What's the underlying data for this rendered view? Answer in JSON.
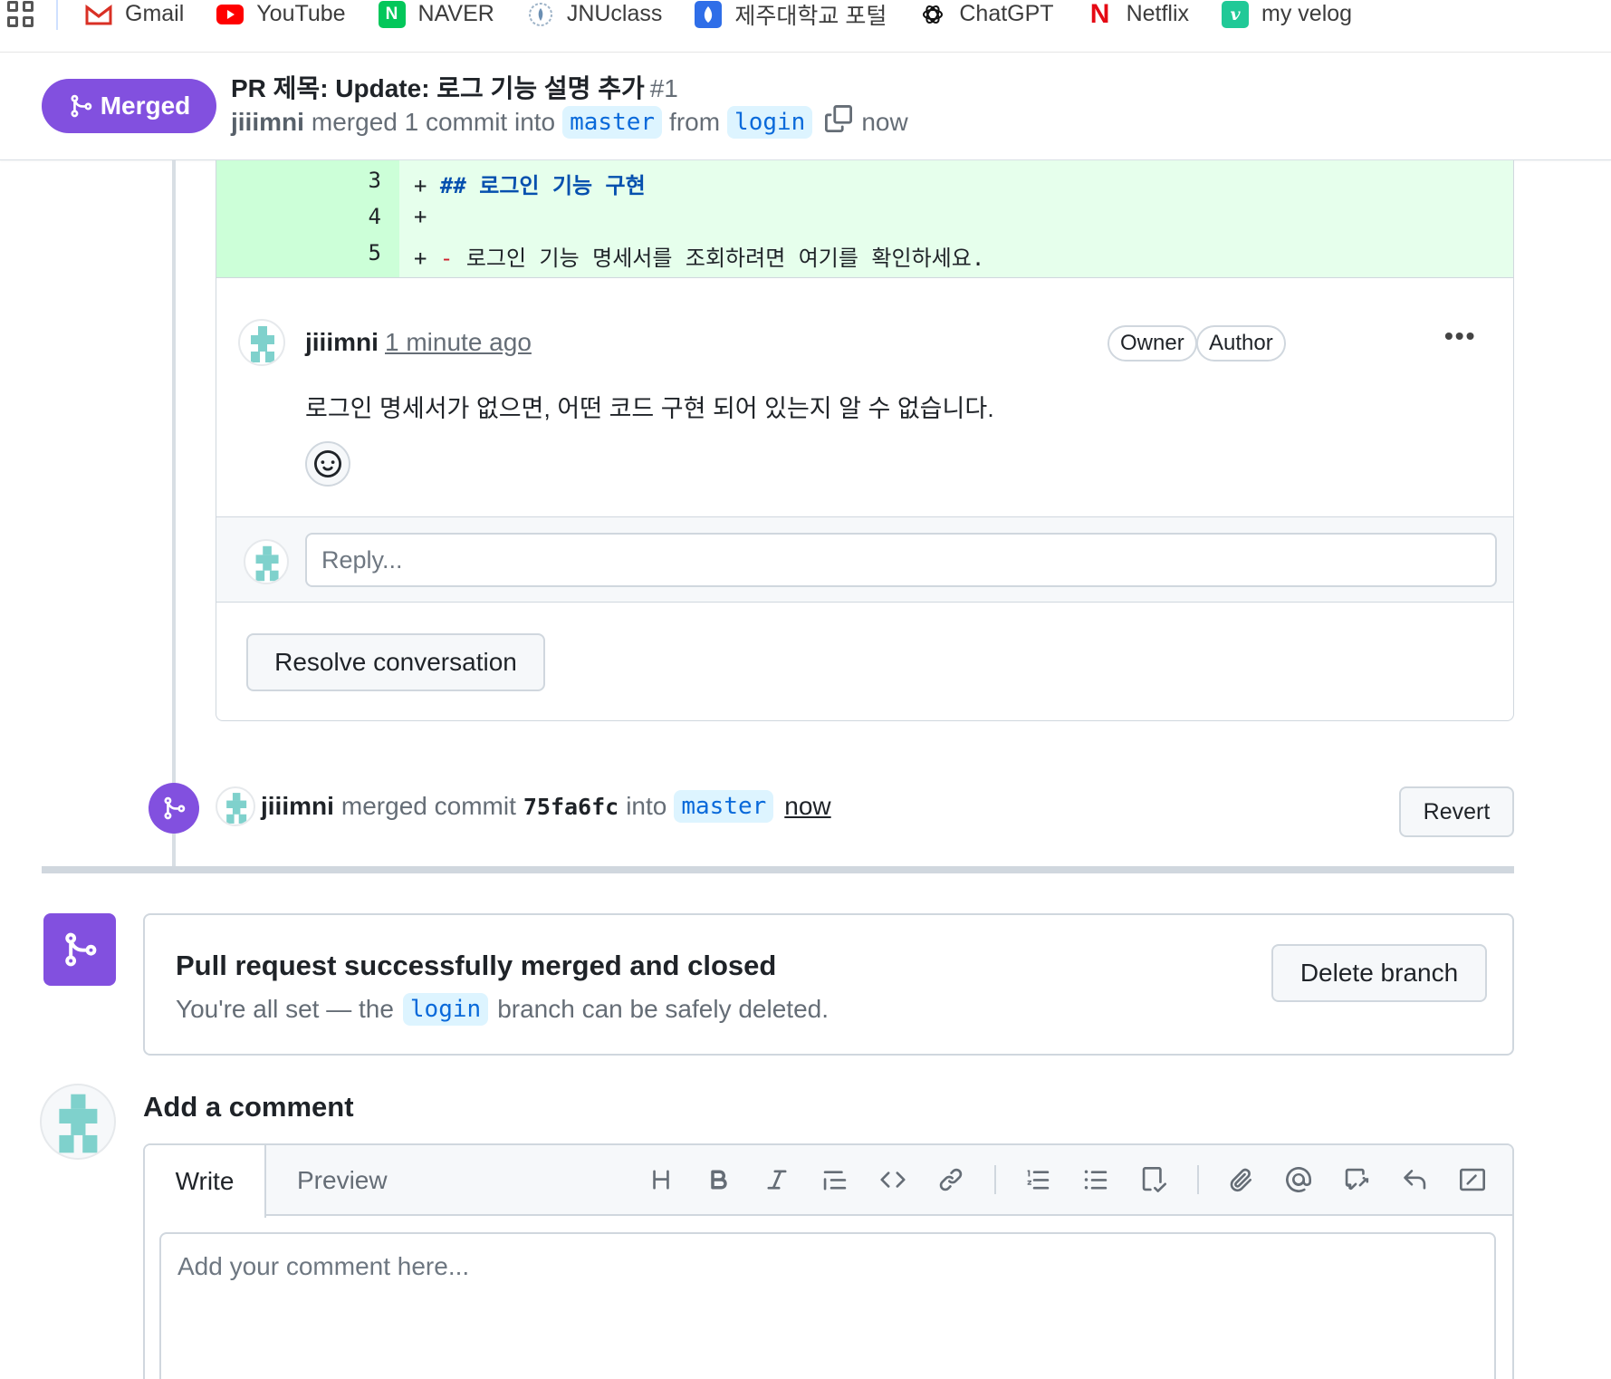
{
  "bookmarks": [
    {
      "label": "Gmail",
      "icon": "gmail-icon",
      "color": "#d93025"
    },
    {
      "label": "YouTube",
      "icon": "youtube-icon",
      "color": "#ff0000"
    },
    {
      "label": "NAVER",
      "icon": "naver-icon",
      "color": "#03c75a"
    },
    {
      "label": "JNUclass",
      "icon": "jnuclass-icon",
      "color": "#6b8fb3"
    },
    {
      "label": "제주대학교 포털",
      "icon": "jeju-portal-icon",
      "color": "#2f6ee8"
    },
    {
      "label": "ChatGPT",
      "icon": "chatgpt-icon",
      "color": "#111111"
    },
    {
      "label": "Netflix",
      "icon": "netflix-icon",
      "color": "#e50914"
    },
    {
      "label": "my velog",
      "icon": "velog-icon",
      "color": "#20c997"
    }
  ],
  "pr": {
    "state": "Merged",
    "title": "PR 제목: Update: 로그 기능 설명 추가",
    "number": "#1",
    "author": "jiiimni",
    "merged_text": "merged 1 commit into",
    "base_branch": "master",
    "from_text": "from",
    "head_branch": "login",
    "time": "now",
    "accent": "#8250df"
  },
  "diff": {
    "rows": [
      {
        "line": "3",
        "plus": "+",
        "md": "## 로그인 기능 구현",
        "dash": "",
        "text": ""
      },
      {
        "line": "4",
        "plus": "+",
        "md": "",
        "dash": "",
        "text": ""
      },
      {
        "line": "5",
        "plus": "+",
        "md": "",
        "dash": "-",
        "text": "로그인 기능 명세서를 조회하려면 여기를 확인하세요."
      }
    ]
  },
  "review_comment": {
    "author": "jiiimni",
    "time": "1 minute ago",
    "badges": [
      "Owner",
      "Author"
    ],
    "more": "•••",
    "body": "로그인 명세서가 없으면, 어떤 코드 구현 되어 있는지 알 수 없습니다.",
    "reply_placeholder": "Reply...",
    "resolve_label": "Resolve conversation"
  },
  "merge_event": {
    "author": "jiiimni",
    "text": "merged commit",
    "sha": "75fa6fc",
    "into": "into",
    "branch": "master",
    "time": "now",
    "revert_label": "Revert"
  },
  "merged_box": {
    "title": "Pull request successfully merged and closed",
    "sub_before": "You're all set — the",
    "branch": "login",
    "sub_after": "branch can be safely deleted.",
    "delete_label": "Delete branch"
  },
  "add_comment": {
    "title": "Add a comment",
    "tab_write": "Write",
    "tab_preview": "Preview",
    "placeholder": "Add your comment here...",
    "toolbar": [
      "heading-icon",
      "bold-icon",
      "italic-icon",
      "quote-icon",
      "code-icon",
      "link-icon",
      "numbered-list-icon",
      "bulleted-list-icon",
      "task-list-icon",
      "attach-icon",
      "mention-icon",
      "cross-reference-icon",
      "reply-icon",
      "slash-command-icon"
    ]
  }
}
